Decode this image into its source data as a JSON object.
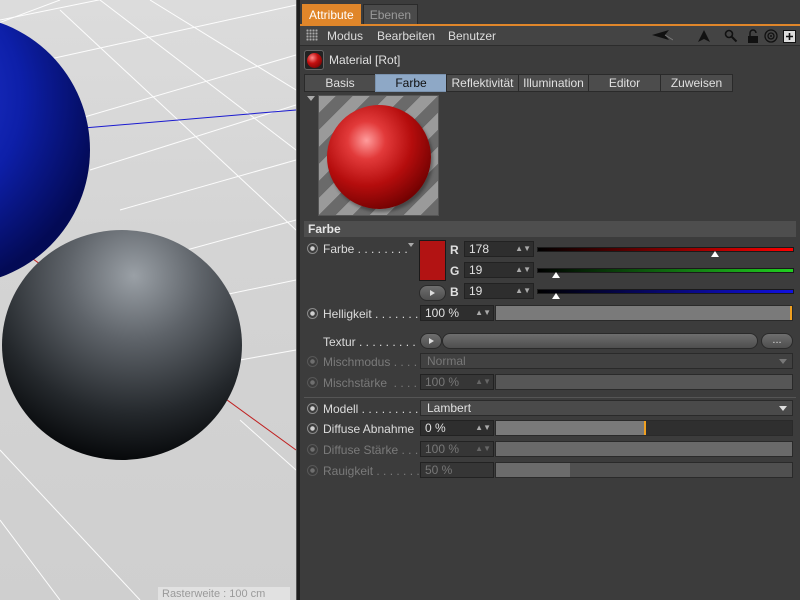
{
  "viewport": {
    "status_text": "Rasterweite : 100 cm"
  },
  "panel": {
    "tabs": [
      {
        "label": "Attribute",
        "active": true
      },
      {
        "label": "Ebenen",
        "active": false
      }
    ],
    "menu": [
      "Modus",
      "Bearbeiten",
      "Benutzer"
    ],
    "toolbar_icons": [
      "arrow-left-icon",
      "arrow-up-icon",
      "search-icon",
      "lock-icon",
      "target-icon",
      "new-panel-icon"
    ],
    "object": {
      "title": "Material [Rot]"
    },
    "subtabs": [
      {
        "label": "Basis",
        "active": false
      },
      {
        "label": "Farbe",
        "active": true
      },
      {
        "label": "Reflektivität",
        "active": false
      },
      {
        "label": "Illumination",
        "active": false
      },
      {
        "label": "Editor",
        "active": false
      },
      {
        "label": "Zuweisen",
        "active": false
      }
    ],
    "section_title": "Farbe",
    "farbe": {
      "label": "Farbe . . . . . . . .",
      "swatch_color": "#b21313",
      "channels": [
        {
          "name": "R",
          "value": "178",
          "fraction": 0.698,
          "gradient": [
            "#000000",
            "#ff0000"
          ]
        },
        {
          "name": "G",
          "value": "19",
          "fraction": 0.075,
          "gradient": [
            "#000000",
            "#20d020"
          ]
        },
        {
          "name": "B",
          "value": "19",
          "fraction": 0.075,
          "gradient": [
            "#000000",
            "#1010e0"
          ]
        }
      ]
    },
    "helligkeit": {
      "label": "Helligkeit . . . . . . .",
      "value": "100 %",
      "fraction": 1.0
    },
    "textur": {
      "label": "Textur . . . . . . . . .",
      "more": "..."
    },
    "mischmodus": {
      "label": "Mischmodus . . . .",
      "value": "Normal"
    },
    "mischstaerke": {
      "label": "Mischstärke  . . . .",
      "value": "100 %"
    },
    "modell": {
      "label": "Modell . . . . . . . . .",
      "value": "Lambert"
    },
    "diffuse_abnahme": {
      "label": "Diffuse Abnahme",
      "value": "0 %",
      "fraction": 0.5
    },
    "diffuse_staerke": {
      "label": "Diffuse Stärke . . .",
      "value": "100 %"
    },
    "rauigkeit": {
      "label": "Rauigkeit . . . . . . .",
      "value": "50 %",
      "fraction": 0.25
    }
  },
  "colors": {
    "accent": "#e0862a",
    "active_subtab": "#8ea8c6",
    "material_red": "#b21313"
  }
}
